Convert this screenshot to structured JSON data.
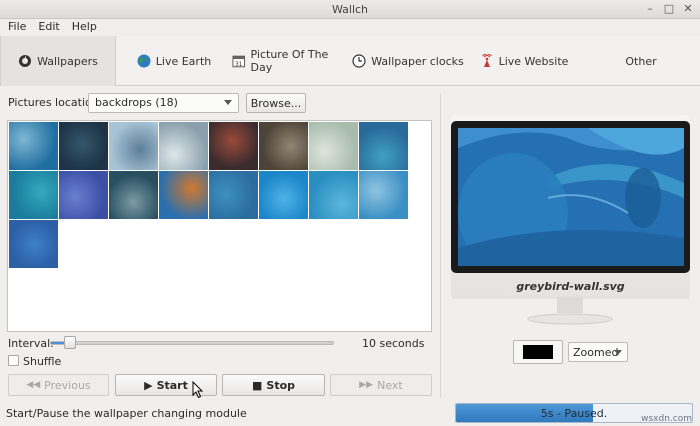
{
  "window": {
    "title": "Wallch"
  },
  "window_controls": [
    {
      "name": "minimize-button",
      "glyph": "–"
    },
    {
      "name": "maximize-button",
      "glyph": "□"
    },
    {
      "name": "close-button",
      "glyph": "✕"
    }
  ],
  "menu": [
    "File",
    "Edit",
    "Help"
  ],
  "tabs": [
    {
      "label": "Wallpapers",
      "icon": "wallpapers-icon",
      "active": true
    },
    {
      "label": "Live Earth",
      "icon": "earth-globe-icon",
      "active": false
    },
    {
      "label": "Picture Of The Day",
      "icon": "calendar-icon",
      "active": false
    },
    {
      "label": "Wallpaper clocks",
      "icon": "clock-icon",
      "active": false
    },
    {
      "label": "Live Website",
      "icon": "broadcast-icon",
      "active": false
    },
    {
      "label": "Other",
      "icon": "",
      "active": false
    }
  ],
  "location": {
    "label": "Pictures location:",
    "value": "backdrops (18)",
    "browse": "Browse..."
  },
  "thumbnails": [
    {
      "c1": "#1f6ea1",
      "c2": "#7fb7d2"
    },
    {
      "c1": "#1c3446",
      "c2": "#37566b"
    },
    {
      "c1": "#a7c3d6",
      "c2": "#5d7f98"
    },
    {
      "c1": "#8aa1ad",
      "c2": "#dfe7ea"
    },
    {
      "c1": "#3a2b2e",
      "c2": "#9a4a3a"
    },
    {
      "c1": "#4c4438",
      "c2": "#928673"
    },
    {
      "c1": "#a8bcae",
      "c2": "#dfe5dc"
    },
    {
      "c1": "#2a6a9a",
      "c2": "#3fa1c2"
    },
    {
      "c1": "#1a7c9a",
      "c2": "#34a8be"
    },
    {
      "c1": "#3b4fa5",
      "c2": "#6b7fd0"
    },
    {
      "c1": "#274f60",
      "c2": "#7c9aa6"
    },
    {
      "c1": "#2a6fad",
      "c2": "#d1792f"
    },
    {
      "c1": "#2b6d9e",
      "c2": "#3e90c2"
    },
    {
      "c1": "#1b86c9",
      "c2": "#4fb2e6"
    },
    {
      "c1": "#2a8ec1",
      "c2": "#5bb7dc"
    },
    {
      "c1": "#3a8fc4",
      "c2": "#8fc4e1"
    },
    {
      "c1": "#2c5fa6",
      "c2": "#3c80c6"
    }
  ],
  "interval": {
    "label": "Interval:",
    "value_text": "10 seconds",
    "fraction": 0.06
  },
  "shuffle": {
    "label": "Shuffle",
    "checked": false
  },
  "controls": {
    "previous": "Previous",
    "start": "Start",
    "stop": "Stop",
    "next": "Next"
  },
  "status": {
    "text": "Start/Pause the wallpaper changing module",
    "progress_text": "5s - Paused.",
    "progress_fraction": 0.58
  },
  "preview": {
    "filename": "greybird-wall.svg",
    "mode": "Zoomed",
    "bg_color": "#000000"
  },
  "watermark": "wsxdn.com",
  "colors": {
    "accent": "#3584c7",
    "screen_bg": "#2570b2"
  }
}
